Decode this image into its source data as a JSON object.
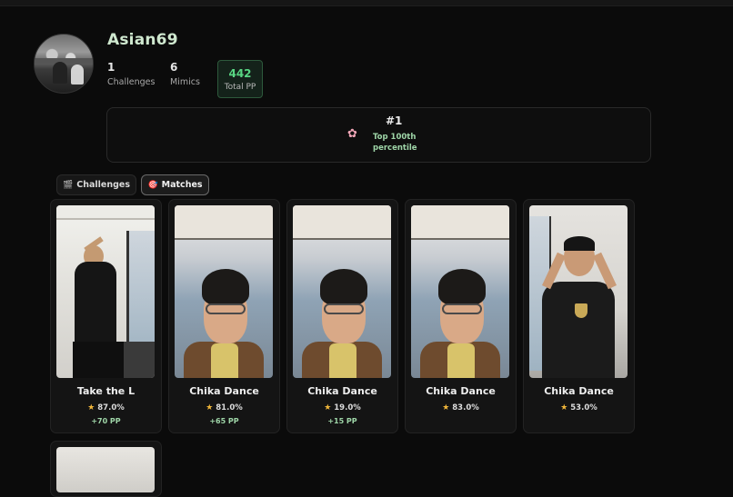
{
  "profile": {
    "username": "Asian69",
    "stats": [
      {
        "value": "1",
        "label": "Challenges"
      },
      {
        "value": "6",
        "label": "Mimics"
      }
    ],
    "total_pp": {
      "value": "442",
      "label": "Total PP"
    }
  },
  "rank": {
    "icon": "flower-icon",
    "position": "#1",
    "subtitle": "Top 100th percentile"
  },
  "tabs": [
    {
      "label": "Challenges",
      "icon": "clapperboard-icon",
      "active": false
    },
    {
      "label": "Matches",
      "icon": "target-icon",
      "active": true
    }
  ],
  "matches": [
    {
      "title": "Take the L",
      "score": "87.0%",
      "pp": "+70 PP",
      "thumb": "room"
    },
    {
      "title": "Chika Dance",
      "score": "81.0%",
      "pp": "+65 PP",
      "thumb": "face"
    },
    {
      "title": "Chika Dance",
      "score": "19.0%",
      "pp": "+15 PP",
      "thumb": "face"
    },
    {
      "title": "Chika Dance",
      "score": "83.0%",
      "pp": "",
      "thumb": "face"
    },
    {
      "title": "Chika Dance",
      "score": "53.0%",
      "pp": "",
      "thumb": "hands"
    }
  ],
  "colors": {
    "background": "#0b0b0b",
    "accent_green": "#58d683",
    "star": "#f0b63a"
  }
}
